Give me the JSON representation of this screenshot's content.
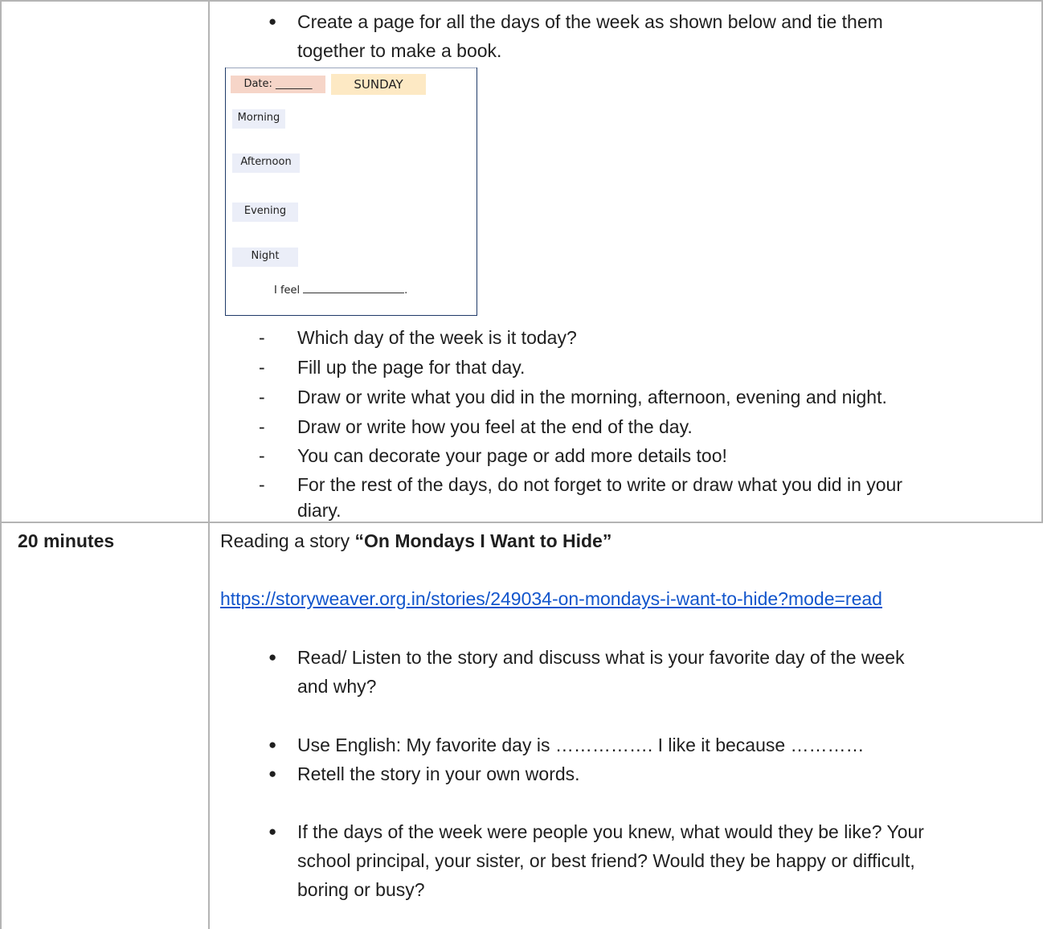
{
  "top_section": {
    "bullet_line1": "Create a page for all the days of the week as shown below and tie them",
    "bullet_line2": "together to make a book.",
    "diary_sample": {
      "date_label": "Date: _______",
      "day": "SUNDAY",
      "slots": [
        "Morning",
        "Afternoon",
        "Evening",
        "Night"
      ],
      "feel_label": "I feel",
      "feel_end": "."
    },
    "dash_items": [
      "Which day of the week is it today?",
      "Fill up the page for that day.",
      "Draw or write what you did in the morning, afternoon, evening and night.",
      "Draw or write how you feel at the end of the day.",
      "You can decorate your page or add more details too!",
      "For the rest of the days, do not forget to write or draw what you did in your"
    ],
    "dash_last_continuation": "diary."
  },
  "reading_section": {
    "time": "20 minutes",
    "intro": "Reading a story ",
    "story_title": "“On Mondays I Want to Hide”",
    "link": "https://storyweaver.org.in/stories/249034-on-mondays-i-want-to-hide?mode=read",
    "b1_line1": "Read/ Listen to the story and discuss what is your favorite day of the week",
    "b1_line2": "and why?",
    "b2": "Use English: My favorite day is ……………. I like it because …………",
    "b3": "Retell the story in your own words.",
    "b4_line1": "If the days of the week were people you knew, what would they be like? Your",
    "b4_line2": "school principal, your sister, or best friend? Would they be happy or difficult,",
    "b4_line3": "boring or busy?"
  }
}
